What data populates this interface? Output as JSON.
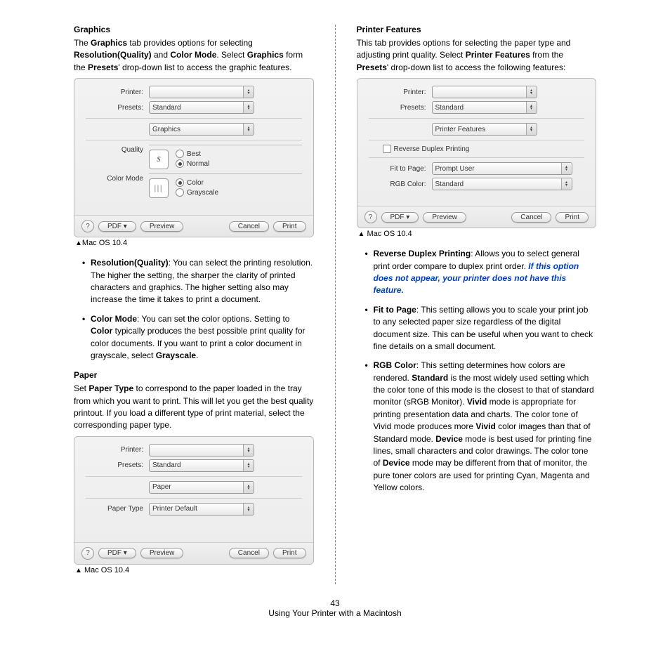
{
  "page": {
    "number": "43",
    "footer": "Using Your Printer with a Macintosh"
  },
  "left": {
    "graphics": {
      "heading": "Graphics",
      "intro_pre": "The ",
      "intro_b1": "Graphics",
      "intro_mid1": " tab provides options for selecting ",
      "intro_b2": "Resolution(Quality)",
      "intro_mid2": " and ",
      "intro_b3": "Color Mode",
      "intro_mid3": ". Select ",
      "intro_b4": "Graphics",
      "intro_mid4": " form the ",
      "intro_b5": "Presets",
      "intro_end": "' drop-down list to access the graphic features.",
      "caption": "Mac OS 10.4",
      "bullets": {
        "res_b": "Resolution(Quality)",
        "res_t": ": You can select the printing resolution. The higher the setting, the sharper the clarity of printed characters and graphics. The higher setting also may increase the time it takes to print a document.",
        "cm_b": "Color Mode",
        "cm_t1": ": You can set the color options. Setting to ",
        "cm_b2": "Color",
        "cm_t2": " typically produces the best possible print quality for color documents. If you want to print a color document in grayscale, select ",
        "cm_b3": "Grayscale",
        "cm_t3": "."
      }
    },
    "paper": {
      "heading": "Paper",
      "intro_pre": "Set ",
      "intro_b": "Paper Type",
      "intro_rest": " to correspond to the paper loaded in the tray from which you want to print. This will let you get the best quality printout. If you load a different type of print material, select the corresponding paper type.",
      "caption": "Mac OS 10.4"
    },
    "dialog1": {
      "printer_label": "Printer:",
      "presets_label": "Presets:",
      "presets_value": "Standard",
      "section_value": "Graphics",
      "quality_label": "Quality",
      "best": "Best",
      "normal": "Normal",
      "colormode_label": "Color Mode",
      "color": "Color",
      "grayscale": "Grayscale",
      "help": "?",
      "pdf": "PDF ▾",
      "preview": "Preview",
      "cancel": "Cancel",
      "print": "Print"
    },
    "dialog2": {
      "printer_label": "Printer:",
      "presets_label": "Presets:",
      "presets_value": "Standard",
      "section_value": "Paper",
      "papertype_label": "Paper Type",
      "papertype_value": "Printer Default",
      "help": "?",
      "pdf": "PDF ▾",
      "preview": "Preview",
      "cancel": "Cancel",
      "print": "Print"
    }
  },
  "right": {
    "pf": {
      "heading": "Printer Features",
      "intro_pre": "This tab provides options for selecting the paper type and adjusting print quality. Select ",
      "intro_b1": "Printer Features",
      "intro_mid": " from the ",
      "intro_b2": "Presets",
      "intro_end": "' drop-down list to access the following features:",
      "caption": "Mac OS 10.4",
      "bullets": {
        "rd_b": "Reverse Duplex Printing",
        "rd_t": ": Allows you to select general print order compare to duplex print order. ",
        "rd_blue": "If this option does not appear, your printer does not have this feature.",
        "fit_b": "Fit to Page",
        "fit_t": ": This setting allows you to scale your print job to any selected paper size regardless of the digital document size. This can be useful when you want to check fine details on a small document.",
        "rgb_b": "RGB Color",
        "rgb_t1": ": This setting determines how colors are rendered. ",
        "rgb_b2": "Standard",
        "rgb_t2": " is the most widely used setting which the color tone of this mode is the closest to that of standard monitor (sRGB Monitor). ",
        "rgb_b3": "Vivid",
        "rgb_t3": " mode is appropriate for printing presentation data and charts. The color tone of Vivid mode produces more ",
        "rgb_b4": "Vivid",
        "rgb_t4": " color images than that of Standard mode. ",
        "rgb_b5": "Device",
        "rgb_t5": " mode is best used for printing fine lines, small characters and color drawings. The color tone of ",
        "rgb_b6": "Device",
        "rgb_t6": " mode may be different from that of monitor, the pure toner colors are used for printing Cyan, Magenta and Yellow colors."
      }
    },
    "dialog3": {
      "printer_label": "Printer:",
      "presets_label": "Presets:",
      "presets_value": "Standard",
      "section_value": "Printer Features",
      "reverse_label": "Reverse Duplex Printing",
      "fit_label": "Fit to Page:",
      "fit_value": "Prompt User",
      "rgb_label": "RGB Color:",
      "rgb_value": "Standard",
      "help": "?",
      "pdf": "PDF ▾",
      "preview": "Preview",
      "cancel": "Cancel",
      "print": "Print"
    }
  }
}
